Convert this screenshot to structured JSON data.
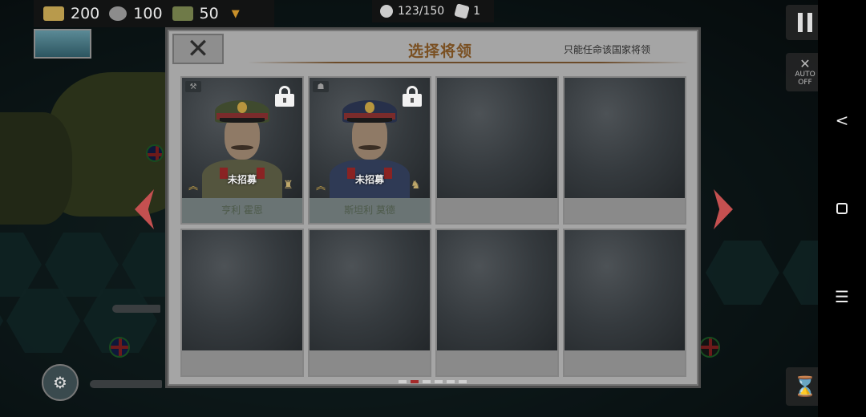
{
  "hud": {
    "resources": [
      {
        "icon": "gold-bars-icon",
        "value": "200"
      },
      {
        "icon": "gear-industry-icon",
        "value": "100"
      },
      {
        "icon": "medal-book-icon",
        "value": "50"
      }
    ],
    "expand_icon": "triangle-down-icon",
    "population": "123/150",
    "cards": "1"
  },
  "controls": {
    "auto_label": "AUTO",
    "auto_state": "OFF"
  },
  "dialog": {
    "title": "选择将领",
    "note": "只能任命该国家将领",
    "close_symbol": "✕",
    "generals": [
      {
        "name": "亨利 霍恩",
        "status": "未招募",
        "type_icon": "artillery-icon",
        "uniform": "#54553e",
        "cap": "#3f4a2e"
      },
      {
        "name": "斯坦利 莫德",
        "status": "未招募",
        "type_icon": "infantry-icon",
        "uniform": "#2f3a55",
        "cap": "#27304a"
      },
      {
        "name": "",
        "status": ""
      },
      {
        "name": "",
        "status": ""
      },
      {
        "name": "",
        "status": ""
      },
      {
        "name": "",
        "status": ""
      },
      {
        "name": "",
        "status": ""
      },
      {
        "name": "",
        "status": ""
      }
    ],
    "pager": {
      "pages": 6,
      "active": 1
    }
  },
  "colors": {
    "accent_red": "#a42a2a",
    "title_brown": "#7a5022",
    "dialog_bg": "#a5a5a5"
  }
}
